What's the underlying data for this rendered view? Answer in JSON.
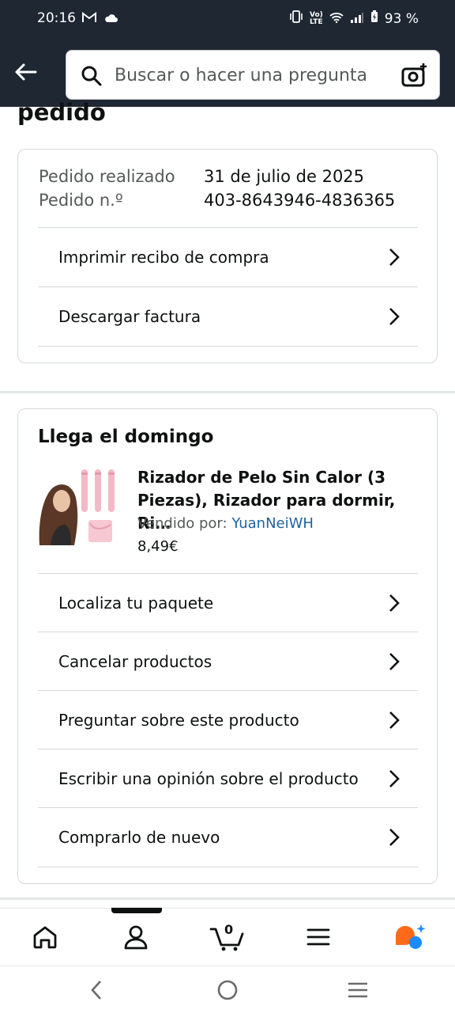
{
  "status_bar": {
    "time": "20:16",
    "battery": "93 %"
  },
  "search": {
    "placeholder": "Buscar o hacer una pregunta"
  },
  "page": {
    "title_fragment": "pedido"
  },
  "order_info": {
    "placed_label": "Pedido realizado",
    "placed_value": "31 de julio de 2025",
    "number_label": "Pedido n.º",
    "number_value": "403-8643946-4836365",
    "actions": [
      {
        "label": "Imprimir recibo de compra"
      },
      {
        "label": "Descargar factura"
      }
    ]
  },
  "shipment": {
    "title": "Llega el domingo",
    "product": {
      "title": "Rizador de Pelo Sin Calor (3 Piezas), Rizador para dormir, Ri…",
      "seller_label": "Vendido por:",
      "seller_name": "YuanNeiWH",
      "price": "8,49€"
    },
    "actions": [
      {
        "label": "Localiza tu paquete"
      },
      {
        "label": "Cancelar productos"
      },
      {
        "label": "Preguntar sobre este producto"
      },
      {
        "label": "Escribir una opinión sobre el producto"
      },
      {
        "label": "Comprarlo de nuevo"
      }
    ]
  },
  "bottom_nav": {
    "cart_count": "0",
    "items": [
      "home-icon",
      "account-icon",
      "cart-icon",
      "menu-icon",
      "rufus-icon"
    ]
  },
  "colors": {
    "header_bg": "#1f2733",
    "link": "#2162a1",
    "rufus_orange": "#ff6a1a",
    "rufus_blue": "#1a8cff"
  }
}
